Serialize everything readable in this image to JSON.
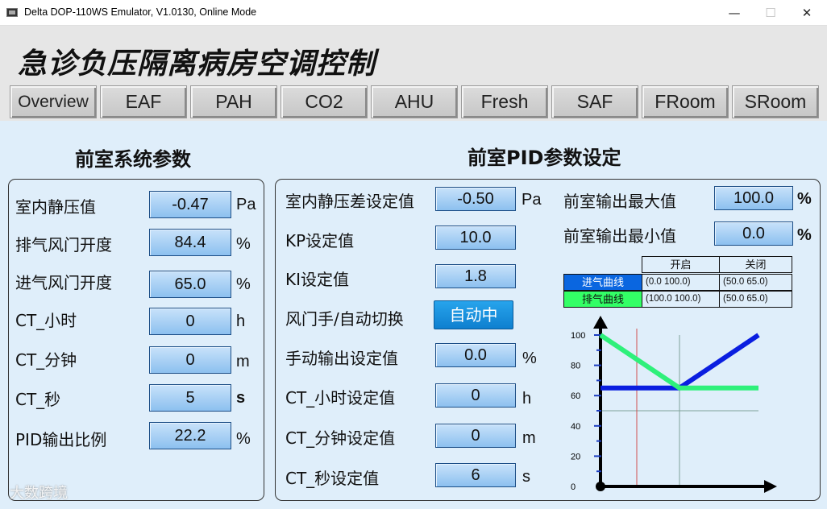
{
  "window": {
    "title": "Delta DOP-110WS Emulator, V1.0130, Online Mode",
    "minimize": "—",
    "maximize": "☐",
    "close": "✕"
  },
  "header": {
    "title": "急诊负压隔离病房空调控制",
    "tabs": [
      "Overview",
      "EAF",
      "PAH",
      "CO2",
      "AHU",
      "Fresh",
      "SAF",
      "FRoom",
      "SRoom"
    ]
  },
  "left": {
    "title": "前室系统参数",
    "rows": [
      {
        "label": "室内静压值",
        "value": "-0.47",
        "unit": "Pa"
      },
      {
        "label": "排气风门开度",
        "value": "84.4",
        "unit": "%"
      },
      {
        "label": "进气风门开度",
        "value": "65.0",
        "unit": "%"
      },
      {
        "label": "CT_小时",
        "value": "0",
        "unit": "h"
      },
      {
        "label": "CT_分钟",
        "value": "0",
        "unit": "m"
      },
      {
        "label": "CT_秒",
        "value": "5",
        "unit": "s"
      },
      {
        "label": "PID输出比例",
        "value": "22.2",
        "unit": "%"
      }
    ]
  },
  "right": {
    "title": "前室PID参数设定",
    "rows": [
      {
        "label": "室内静压差设定值",
        "value": "-0.50",
        "unit": "Pa"
      },
      {
        "label": "KP设定值",
        "value": "10.0",
        "unit": ""
      },
      {
        "label": "KI设定值",
        "value": "1.8",
        "unit": ""
      },
      {
        "label": "风门手/自动切换",
        "button": "自动中"
      },
      {
        "label": "手动输出设定值",
        "value": "0.0",
        "unit": "%"
      },
      {
        "label": "CT_小时设定值",
        "value": "0",
        "unit": "h"
      },
      {
        "label": "CT_分钟设定值",
        "value": "0",
        "unit": "m"
      },
      {
        "label": "CT_秒设定值",
        "value": "6",
        "unit": "s"
      }
    ],
    "max_label": "前室输出最大值",
    "max_value": "100.0",
    "max_unit": "%",
    "min_label": "前室输出最小值",
    "min_value": "0.0",
    "min_unit": "%"
  },
  "curve_table": {
    "col_open": "开启",
    "col_close": "关闭",
    "rows": [
      {
        "label": "进气曲线",
        "open": "(0.0      100.0)",
        "close": "(50.0    65.0)",
        "color": "#0a66e0"
      },
      {
        "label": "排气曲线",
        "open": "(100.0  100.0)",
        "close": "(50.0    65.0)",
        "color": "#33ff66"
      }
    ]
  },
  "chart_data": {
    "type": "line",
    "ylim": [
      0,
      100
    ],
    "yticks": [
      "0",
      "20",
      "40",
      "60",
      "80",
      "100"
    ],
    "series": [
      {
        "color": "#0a1ee0",
        "points": [
          [
            0,
            65
          ],
          [
            50,
            65
          ],
          [
            100,
            100
          ]
        ]
      },
      {
        "color": "#2ef07a",
        "points": [
          [
            0,
            100
          ],
          [
            50,
            65
          ],
          [
            100,
            65
          ]
        ]
      }
    ]
  },
  "watermark": "大数跨境"
}
